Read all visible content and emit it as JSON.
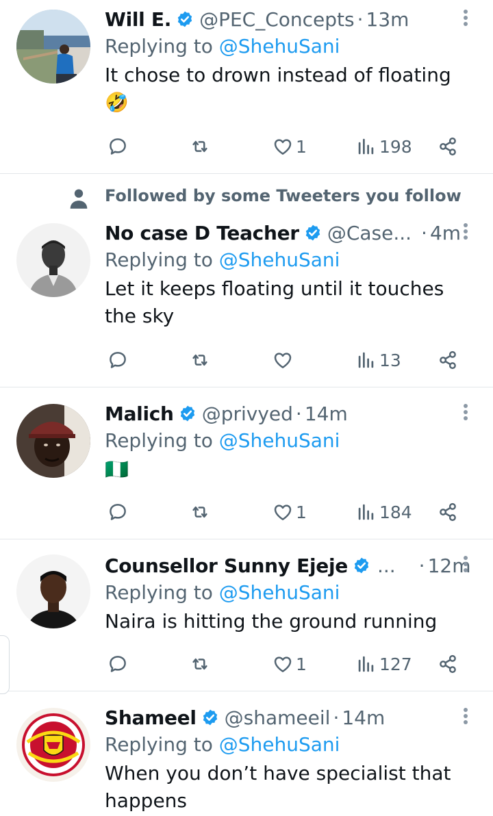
{
  "tweets": [
    {
      "name": "Will E.",
      "handle": "@PEC_Concepts",
      "separator": "·",
      "time": "13m",
      "reply_prefix": "Replying to ",
      "reply_handle": "@ShehuSani",
      "text": "It chose to drown instead of floating",
      "emoji": "🤣",
      "likes": "1",
      "views": "198"
    },
    {
      "social_context": "Followed by some Tweeters you follow",
      "name": "No case D Teacher",
      "handle": "@Case...",
      "separator": "·",
      "time": "4m",
      "reply_prefix": "Replying to ",
      "reply_handle": "@ShehuSani",
      "text": "Let it keeps floating until it touches the sky",
      "likes": "",
      "views": "13"
    },
    {
      "name": "Malich",
      "handle": "@privyed",
      "separator": "·",
      "time": "14m",
      "reply_prefix": "Replying to ",
      "reply_handle": "@ShehuSani",
      "text": "🇳🇬",
      "likes": "1",
      "views": "184"
    },
    {
      "name": "Counsellor Sunny Ejeje",
      "handle": "...",
      "separator": "·",
      "time": "12m",
      "reply_prefix": "Replying to ",
      "reply_handle": "@ShehuSani",
      "text": "Naira is hitting the ground running",
      "likes": "1",
      "views": "127"
    },
    {
      "name": "Shameel",
      "handle": "@shameeil",
      "separator": "·",
      "time": "14m",
      "reply_prefix": "Replying to ",
      "reply_handle": "@ShehuSani",
      "text": "When you don’t have specialist that happens"
    }
  ],
  "icons": {
    "reply": "reply-icon",
    "retweet": "retweet-icon",
    "like": "heart-icon",
    "views": "views-icon",
    "share": "share-icon",
    "verified": "verified-badge-icon",
    "more": "more-options-icon"
  },
  "colors": {
    "accent": "#1d9bf0",
    "secondary_text": "#536471",
    "primary_text": "#0f1419",
    "divider": "#e3e7ea"
  }
}
